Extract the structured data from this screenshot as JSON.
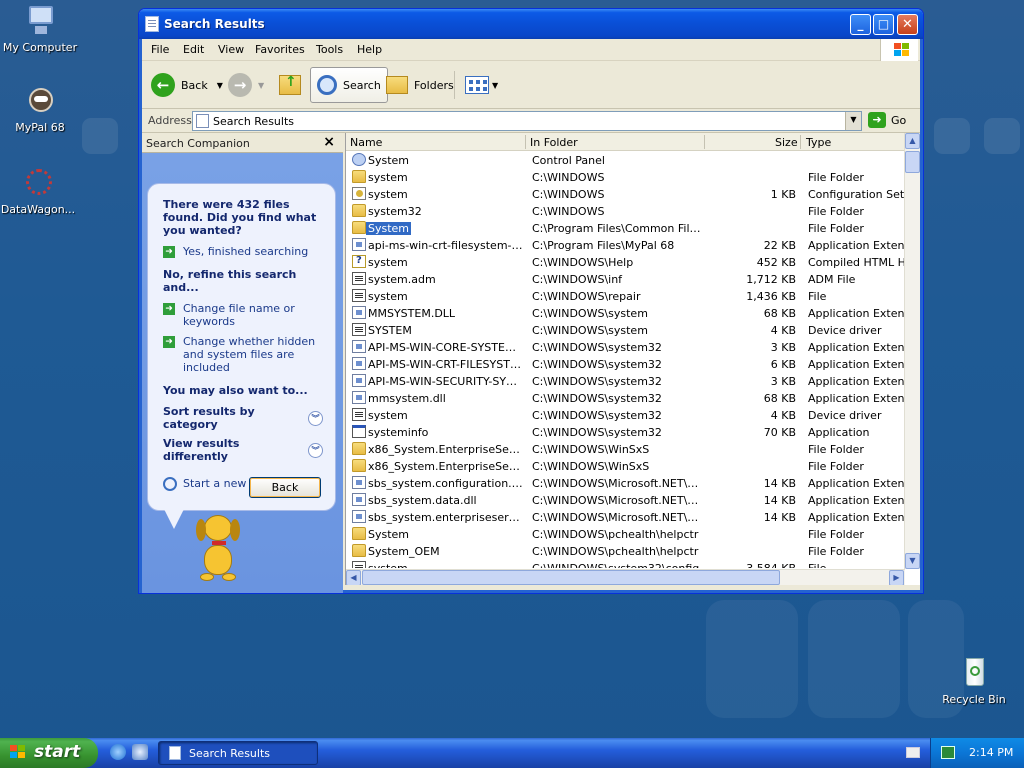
{
  "desktop": {
    "icons": [
      {
        "label": "My Computer"
      },
      {
        "label": "MyPal 68"
      },
      {
        "label": "DataWagon..."
      },
      {
        "label": "Recycle Bin"
      }
    ]
  },
  "window": {
    "title": "Search Results",
    "menu": [
      "File",
      "Edit",
      "View",
      "Favorites",
      "Tools",
      "Help"
    ],
    "toolbar": {
      "back": "Back",
      "search": "Search",
      "folders": "Folders"
    },
    "address": {
      "label": "Address",
      "value": "Search Results",
      "go": "Go"
    }
  },
  "companion": {
    "header": "Search Companion",
    "found": "There were 432 files found. Did you find what you wanted?",
    "yes": "Yes, finished searching",
    "refine": "No, refine this search and...",
    "change_name": "Change file name or keywords",
    "change_hidden": "Change whether hidden and system files are included",
    "also": "You may also want to...",
    "sort": "Sort results by category",
    "view": "View results differently",
    "new_search": "Start a new search",
    "back": "Back"
  },
  "columns": {
    "name": "Name",
    "folder": "In Folder",
    "size": "Size",
    "type": "Type"
  },
  "files": [
    {
      "icon": "cpl",
      "name": "System",
      "folder": "Control Panel",
      "size": "",
      "type": ""
    },
    {
      "icon": "folder",
      "name": "system",
      "folder": "C:\\WINDOWS",
      "size": "",
      "type": "File Folder"
    },
    {
      "icon": "cfg",
      "name": "system",
      "folder": "C:\\WINDOWS",
      "size": "1 KB",
      "type": "Configuration Settings"
    },
    {
      "icon": "folder",
      "name": "system32",
      "folder": "C:\\WINDOWS",
      "size": "",
      "type": "File Folder"
    },
    {
      "icon": "folder",
      "name": "System",
      "folder": "C:\\Program Files\\Common Files",
      "size": "",
      "type": "File Folder",
      "selected": true
    },
    {
      "icon": "dll",
      "name": "api-ms-win-crt-filesystem-l1-1...",
      "folder": "C:\\Program Files\\MyPal 68",
      "size": "22 KB",
      "type": "Application Extension"
    },
    {
      "icon": "help",
      "name": "system",
      "folder": "C:\\WINDOWS\\Help",
      "size": "452 KB",
      "type": "Compiled HTML Help"
    },
    {
      "icon": "sys",
      "name": "system.adm",
      "folder": "C:\\WINDOWS\\inf",
      "size": "1,712 KB",
      "type": "ADM File"
    },
    {
      "icon": "sys",
      "name": "system",
      "folder": "C:\\WINDOWS\\repair",
      "size": "1,436 KB",
      "type": "File"
    },
    {
      "icon": "dll",
      "name": "MMSYSTEM.DLL",
      "folder": "C:\\WINDOWS\\system",
      "size": "68 KB",
      "type": "Application Extension"
    },
    {
      "icon": "sys",
      "name": "SYSTEM",
      "folder": "C:\\WINDOWS\\system",
      "size": "4 KB",
      "type": "Device driver"
    },
    {
      "icon": "dll",
      "name": "API-MS-WIN-CORE-SYSTEMT...",
      "folder": "C:\\WINDOWS\\system32",
      "size": "3 KB",
      "type": "Application Extension"
    },
    {
      "icon": "dll",
      "name": "API-MS-WIN-CRT-FILESYSTE...",
      "folder": "C:\\WINDOWS\\system32",
      "size": "6 KB",
      "type": "Application Extension"
    },
    {
      "icon": "dll",
      "name": "API-MS-WIN-SECURITY-SYST...",
      "folder": "C:\\WINDOWS\\system32",
      "size": "3 KB",
      "type": "Application Extension"
    },
    {
      "icon": "dll",
      "name": "mmsystem.dll",
      "folder": "C:\\WINDOWS\\system32",
      "size": "68 KB",
      "type": "Application Extension"
    },
    {
      "icon": "sys",
      "name": "system",
      "folder": "C:\\WINDOWS\\system32",
      "size": "4 KB",
      "type": "Device driver"
    },
    {
      "icon": "app",
      "name": "systeminfo",
      "folder": "C:\\WINDOWS\\system32",
      "size": "70 KB",
      "type": "Application"
    },
    {
      "icon": "folder",
      "name": "x86_System.EnterpriseServic...",
      "folder": "C:\\WINDOWS\\WinSxS",
      "size": "",
      "type": "File Folder"
    },
    {
      "icon": "folder",
      "name": "x86_System.EnterpriseServic...",
      "folder": "C:\\WINDOWS\\WinSxS",
      "size": "",
      "type": "File Folder"
    },
    {
      "icon": "dll",
      "name": "sbs_system.configuration.inst...",
      "folder": "C:\\WINDOWS\\Microsoft.NET\\Fr...",
      "size": "14 KB",
      "type": "Application Extension"
    },
    {
      "icon": "dll",
      "name": "sbs_system.data.dll",
      "folder": "C:\\WINDOWS\\Microsoft.NET\\Fr...",
      "size": "14 KB",
      "type": "Application Extension"
    },
    {
      "icon": "dll",
      "name": "sbs_system.enterpriseservice...",
      "folder": "C:\\WINDOWS\\Microsoft.NET\\Fr...",
      "size": "14 KB",
      "type": "Application Extension"
    },
    {
      "icon": "folder",
      "name": "System",
      "folder": "C:\\WINDOWS\\pchealth\\helpctr",
      "size": "",
      "type": "File Folder"
    },
    {
      "icon": "folder",
      "name": "System_OEM",
      "folder": "C:\\WINDOWS\\pchealth\\helpctr",
      "size": "",
      "type": "File Folder"
    },
    {
      "icon": "sys",
      "name": "system",
      "folder": "C:\\WINDOWS\\system32\\config",
      "size": "3,584 KB",
      "type": "File"
    }
  ],
  "taskbar": {
    "start": "start",
    "task": "Search Results",
    "time": "2:14 PM"
  }
}
